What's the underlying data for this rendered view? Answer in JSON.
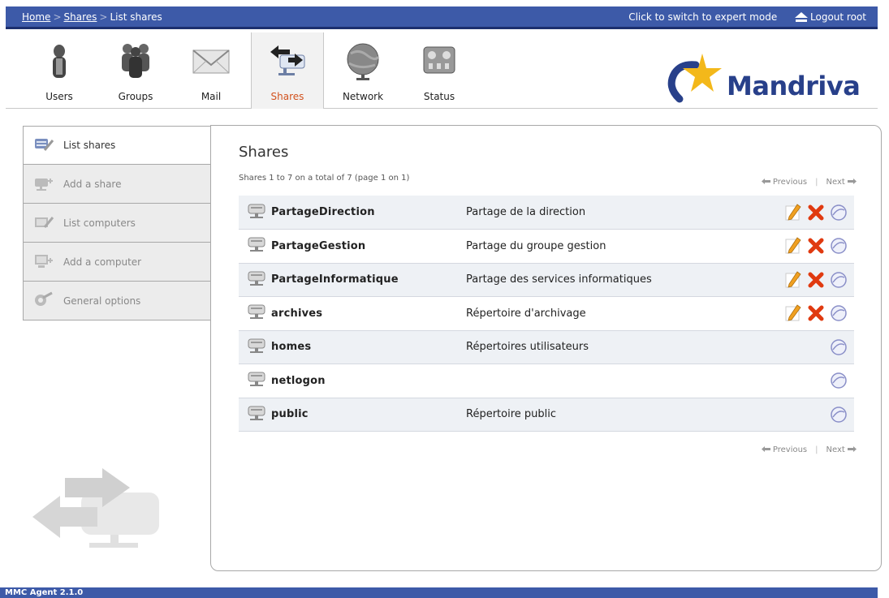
{
  "topbar": {
    "breadcrumb": [
      {
        "label": "Home",
        "link": true
      },
      {
        "label": "Shares",
        "link": true
      },
      {
        "label": "List shares",
        "link": false
      }
    ],
    "separator": ">",
    "expert_mode_label": "Click to switch to expert mode",
    "logout_label": "Logout root",
    "color": "#3d5aa8"
  },
  "nav": {
    "items": [
      {
        "label": "Users",
        "icon": "users-icon"
      },
      {
        "label": "Groups",
        "icon": "groups-icon"
      },
      {
        "label": "Mail",
        "icon": "mail-icon"
      },
      {
        "label": "Shares",
        "icon": "shares-icon",
        "active": true
      },
      {
        "label": "Network",
        "icon": "network-icon"
      },
      {
        "label": "Status",
        "icon": "status-icon"
      }
    ],
    "active_color": "#d2521e"
  },
  "logo": {
    "text": "Mandriva"
  },
  "sidebar": {
    "items": [
      {
        "label": "List shares",
        "icon": "list-shares-icon",
        "active": true
      },
      {
        "label": "Add a share",
        "icon": "add-share-icon"
      },
      {
        "label": "List computers",
        "icon": "list-computers-icon"
      },
      {
        "label": "Add a computer",
        "icon": "add-computer-icon"
      },
      {
        "label": "General options",
        "icon": "general-options-icon"
      }
    ]
  },
  "main": {
    "title": "Shares",
    "page_info": "Shares 1 to 7 on a total of 7 (page 1 on 1)",
    "pager": {
      "previous": "Previous",
      "next": "Next"
    },
    "shares": [
      {
        "name": "PartageDirection",
        "description": "Partage de la direction",
        "editable": true
      },
      {
        "name": "PartageGestion",
        "description": "Partage du groupe gestion",
        "editable": true
      },
      {
        "name": "PartageInformatique",
        "description": "Partage des services informatiques",
        "editable": true
      },
      {
        "name": "archives",
        "description": "Répertoire d'archivage",
        "editable": true
      },
      {
        "name": "homes",
        "description": "Répertoires utilisateurs",
        "editable": false
      },
      {
        "name": "netlogon",
        "description": "",
        "editable": false
      },
      {
        "name": "public",
        "description": "Répertoire public",
        "editable": false
      }
    ]
  },
  "footer": {
    "version": "MMC Agent 2.1.0"
  }
}
